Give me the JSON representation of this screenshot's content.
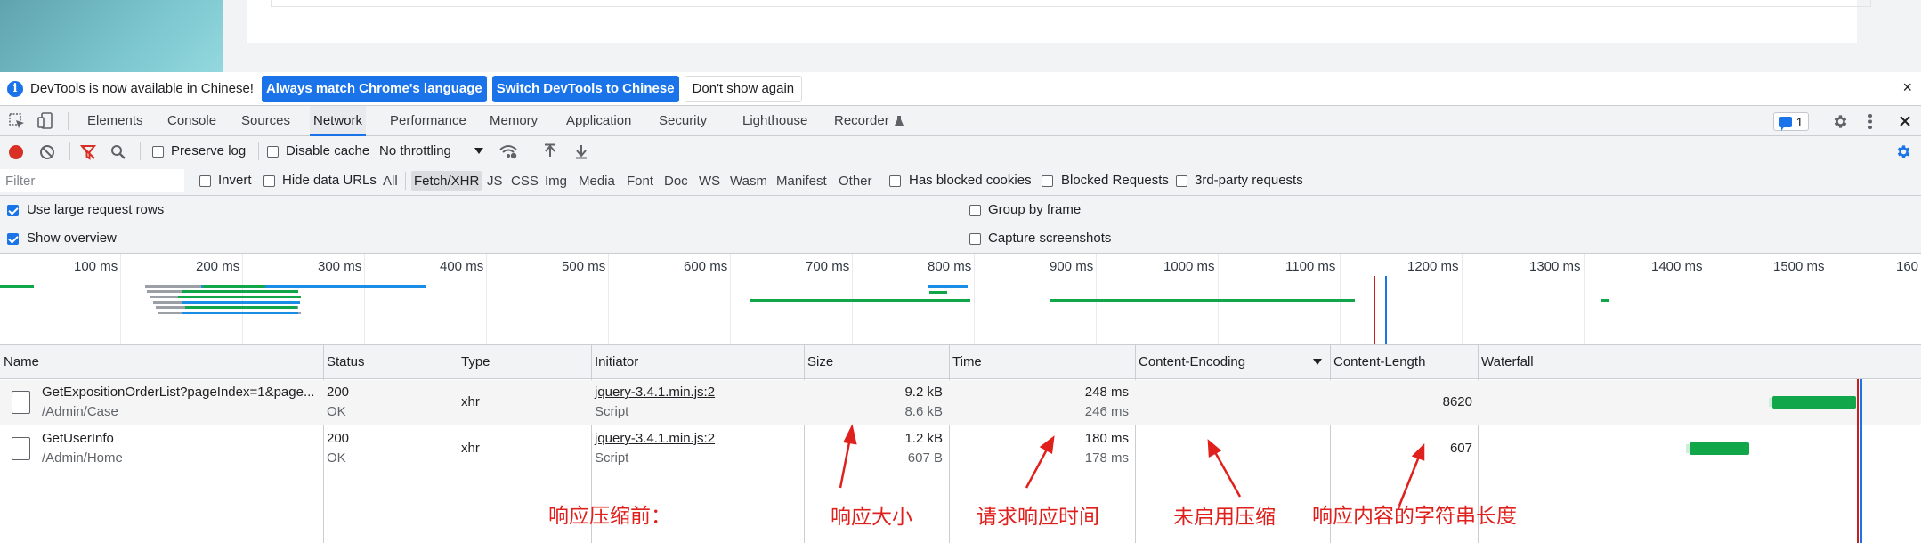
{
  "infobar": {
    "message": "DevTools is now available in Chinese!",
    "btn_match": "Always match Chrome's language",
    "btn_switch": "Switch DevTools to Chinese",
    "btn_dont_show": "Don't show again",
    "close": "×"
  },
  "tabs": [
    "Elements",
    "Console",
    "Sources",
    "Network",
    "Performance",
    "Memory",
    "Application",
    "Security",
    "Lighthouse",
    "Recorder"
  ],
  "active_tab": "Network",
  "issues_count": "1",
  "toolbar": {
    "preserve_log": "Preserve log",
    "disable_cache": "Disable cache",
    "throttling": "No throttling"
  },
  "filter": {
    "placeholder": "Filter",
    "invert": "Invert",
    "hide_data_urls": "Hide data URLs",
    "types": [
      "All",
      "Fetch/XHR",
      "JS",
      "CSS",
      "Img",
      "Media",
      "Font",
      "Doc",
      "WS",
      "Wasm",
      "Manifest",
      "Other"
    ],
    "active_type": "Fetch/XHR",
    "has_blocked_cookies": "Has blocked cookies",
    "blocked_requests": "Blocked Requests",
    "third_party": "3rd-party requests"
  },
  "settings": {
    "large_rows": "Use large request rows",
    "show_overview": "Show overview",
    "group_by_frame": "Group by frame",
    "capture_screenshots": "Capture screenshots"
  },
  "overview_ticks": [
    "100 ms",
    "200 ms",
    "300 ms",
    "400 ms",
    "500 ms",
    "600 ms",
    "700 ms",
    "800 ms",
    "900 ms",
    "1000 ms",
    "1100 ms",
    "1200 ms",
    "1300 ms",
    "1400 ms",
    "1500 ms",
    "160"
  ],
  "columns": [
    "Name",
    "Status",
    "Type",
    "Initiator",
    "Size",
    "Time",
    "Content-Encoding",
    "Content-Length",
    "Waterfall"
  ],
  "rows": [
    {
      "name": "GetExpositionOrderList?pageIndex=1&page...",
      "path": "/Admin/Case",
      "status": "200",
      "status_text": "OK",
      "type": "xhr",
      "initiator": "jquery-3.4.1.min.js:2",
      "initiator_sub": "Script",
      "size": "9.2 kB",
      "size_sub": "8.6 kB",
      "time": "248 ms",
      "time_sub": "246 ms",
      "content_encoding": "",
      "content_length": "8620"
    },
    {
      "name": "GetUserInfo",
      "path": "/Admin/Home",
      "status": "200",
      "status_text": "OK",
      "type": "xhr",
      "initiator": "jquery-3.4.1.min.js:2",
      "initiator_sub": "Script",
      "size": "1.2 kB",
      "size_sub": "607 B",
      "time": "180 ms",
      "time_sub": "178 ms",
      "content_encoding": "",
      "content_length": "607"
    }
  ],
  "annotations": {
    "before_compression": "响应压缩前：",
    "response_size": "响应大小",
    "request_time": "请求响应时间",
    "no_compression": "未启用压缩",
    "content_length": "响应内容的字符串长度"
  },
  "colors": {
    "accent": "#1a73e8",
    "record": "#d93025",
    "waterfall": "#11a64a",
    "annotation": "#e0201c"
  }
}
